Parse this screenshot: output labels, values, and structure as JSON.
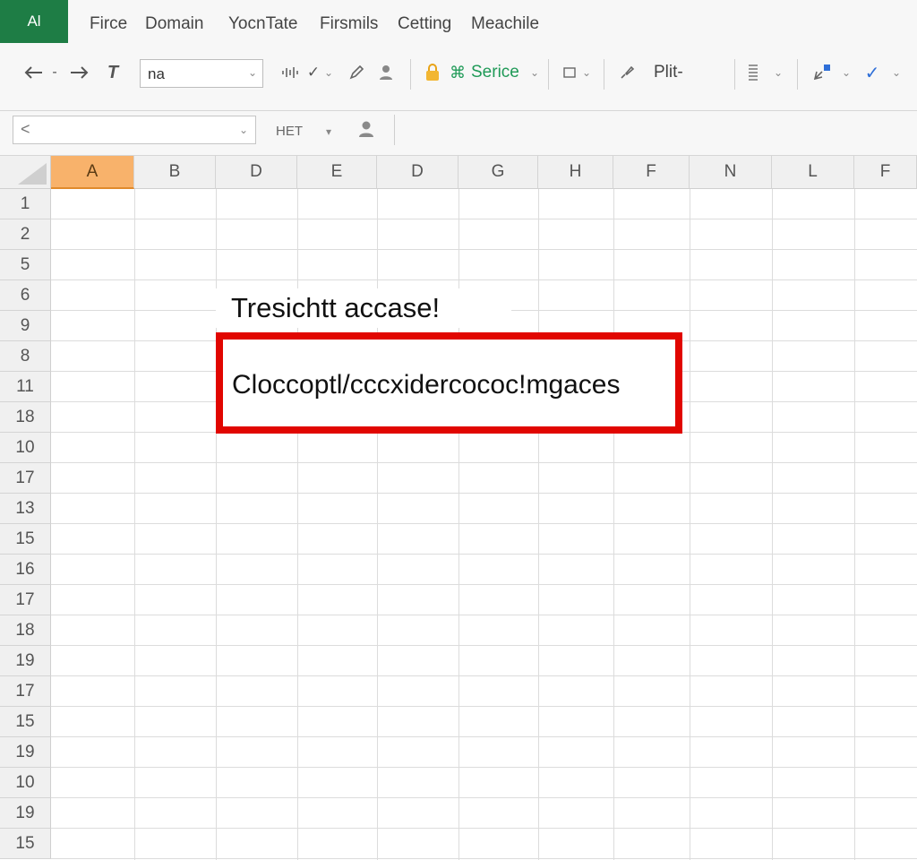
{
  "app": {
    "badge": "Al"
  },
  "menu": [
    "Firce",
    "Domain",
    "YocnTate",
    "Firsmils",
    "Cetting",
    "Meachile"
  ],
  "toolbar": {
    "font_value": "na",
    "style_label": "Serice",
    "plit_label": "Plit-"
  },
  "formula_bar": {
    "name_box": "<",
    "label": "HET"
  },
  "sheet": {
    "columns": [
      "A",
      "B",
      "D",
      "E",
      "D",
      "G",
      "H",
      "F",
      "N",
      "L",
      "F"
    ],
    "active_column": "A",
    "rows": [
      "1",
      "2",
      "5",
      "6",
      "9",
      "8",
      "11",
      "18",
      "10",
      "17",
      "13",
      "15",
      "16",
      "17",
      "18",
      "19",
      "17",
      "15",
      "19",
      "10",
      "19",
      "15"
    ]
  },
  "overlay": {
    "title": "Tresichtt accase!",
    "highlight_text": "Cloccoptl/cccxidercococ!mgaces",
    "highlight_color": "#e10600"
  },
  "colors": {
    "brand": "#1e7d45",
    "active_header": "#f8b26b",
    "accent_green": "#1f9a57",
    "accent_blue": "#2f6fd8"
  }
}
